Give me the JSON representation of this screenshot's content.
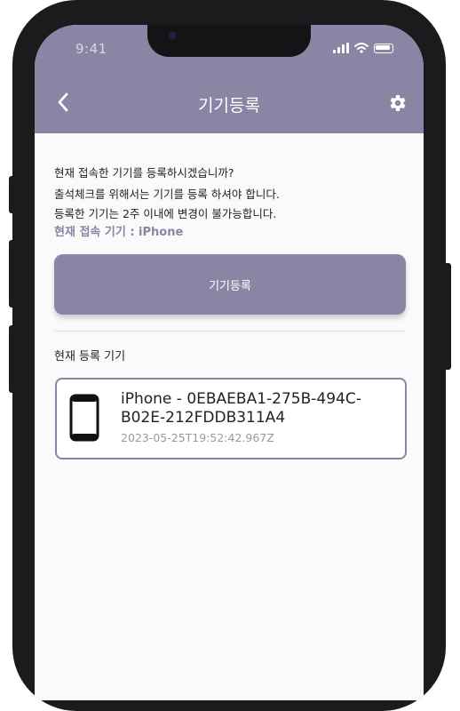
{
  "status_bar": {
    "time": "9:41"
  },
  "nav": {
    "title": "기기등록"
  },
  "info": {
    "line1": "현재 접속한 기기를 등록하시겠습니까?",
    "line2": "출석체크를 위해서는 기기를 등록 하셔야 합니다.",
    "line3": "등록한 기기는 2주 이내에 변경이 불가능합니다.",
    "current_device": "현재 접속 기기 : iPhone"
  },
  "register_button_label": "기기등록",
  "section_label": "현재 등록 기기",
  "registered_device": {
    "name": "iPhone - 0EBAEBA1-275B-494C-B02E-212FDDB311A4",
    "date": "2023-05-25T19:52:42.967Z",
    "icon": "phone-icon"
  },
  "colors": {
    "accent": "#8a85a4",
    "background": "#fafafa"
  }
}
